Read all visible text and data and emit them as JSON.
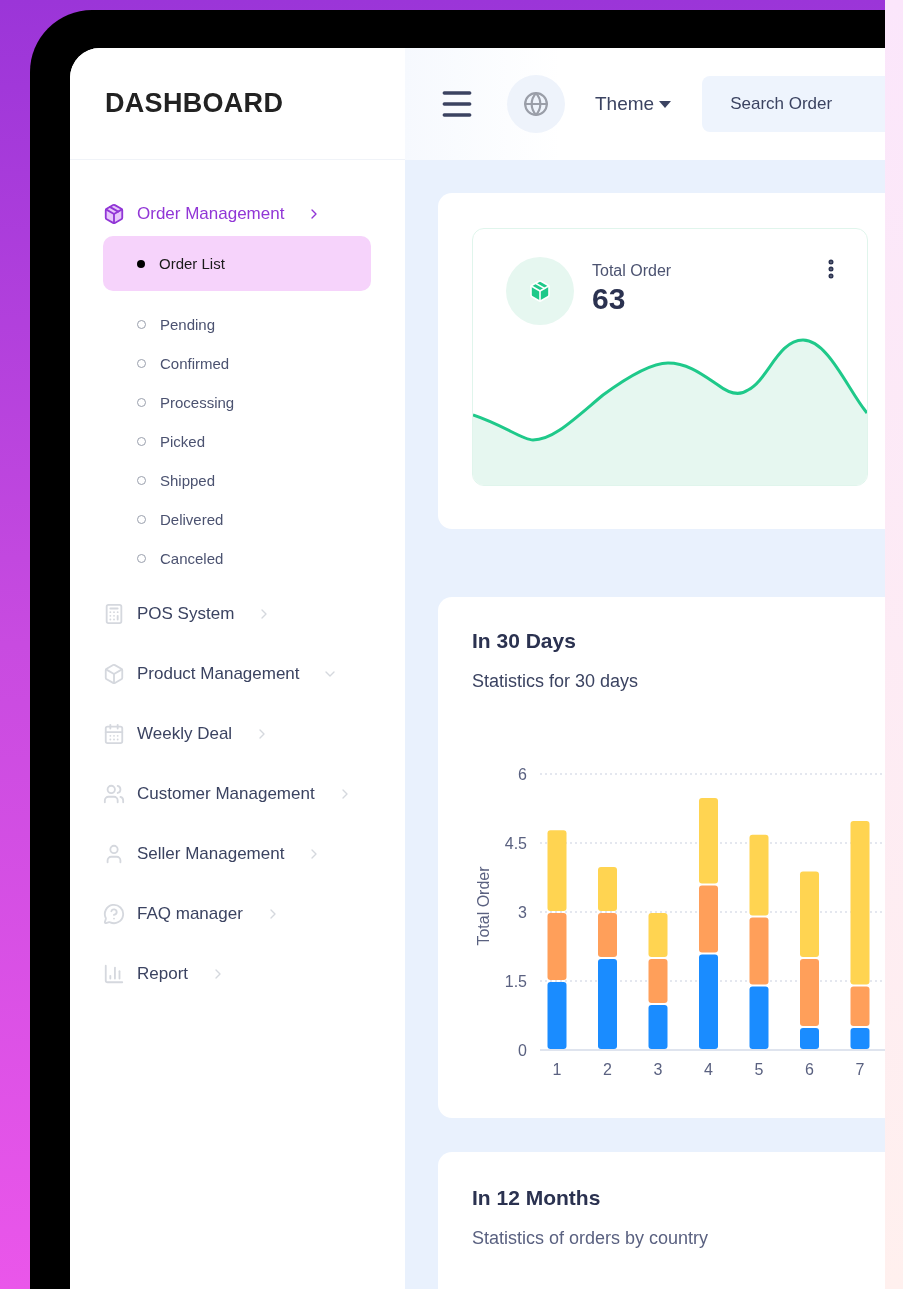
{
  "sidebar": {
    "title": "DASHBOARD",
    "items": [
      {
        "label": "Order Management",
        "selected": true,
        "expanded": false,
        "children": [
          {
            "label": "Order List",
            "selected": true
          },
          {
            "label": "Pending",
            "selected": false
          },
          {
            "label": "Confirmed",
            "selected": false
          },
          {
            "label": "Processing",
            "selected": false
          },
          {
            "label": "Picked",
            "selected": false
          },
          {
            "label": "Shipped",
            "selected": false
          },
          {
            "label": "Delivered",
            "selected": false
          },
          {
            "label": "Canceled",
            "selected": false
          }
        ]
      },
      {
        "label": "POS System",
        "selected": false,
        "expanded": false
      },
      {
        "label": "Product Management",
        "selected": false,
        "expanded": true
      },
      {
        "label": "Weekly Deal",
        "selected": false,
        "expanded": false
      },
      {
        "label": "Customer Management",
        "selected": false,
        "expanded": false
      },
      {
        "label": "Seller Management",
        "selected": false,
        "expanded": false
      },
      {
        "label": "FAQ manager",
        "selected": false,
        "expanded": false
      },
      {
        "label": "Report",
        "selected": false,
        "expanded": false
      }
    ]
  },
  "header": {
    "theme_label": "Theme",
    "search": {
      "placeholder": "Search Order"
    }
  },
  "summary_card": {
    "label": "Total Order",
    "value": "63"
  },
  "stats_30": {
    "title": "In 30 Days",
    "subtitle": "Statistics for 30 days",
    "chart_data": {
      "type": "bar",
      "ylabel": "Total Order",
      "categories": [
        "1",
        "2",
        "3",
        "4",
        "5",
        "6",
        "7"
      ],
      "stacked": true,
      "grid": true,
      "ylim": [
        0,
        6
      ],
      "yticks": [
        0,
        1.5,
        3,
        4.5,
        6
      ],
      "series": [
        {
          "color": "#1a8cff",
          "values": [
            1.5,
            2,
            1,
            2.1,
            1.4,
            0.5,
            0.5
          ]
        },
        {
          "color": "#ff9f5a",
          "values": [
            1.5,
            1,
            1,
            1.5,
            1.5,
            1.5,
            0.9
          ]
        },
        {
          "color": "#ffd451",
          "values": [
            1.8,
            1,
            1,
            1.9,
            1.8,
            1.9,
            3.6
          ]
        }
      ]
    }
  },
  "stats_12": {
    "title": "In 12 Months",
    "subtitle": "Statistics of orders by country"
  }
}
